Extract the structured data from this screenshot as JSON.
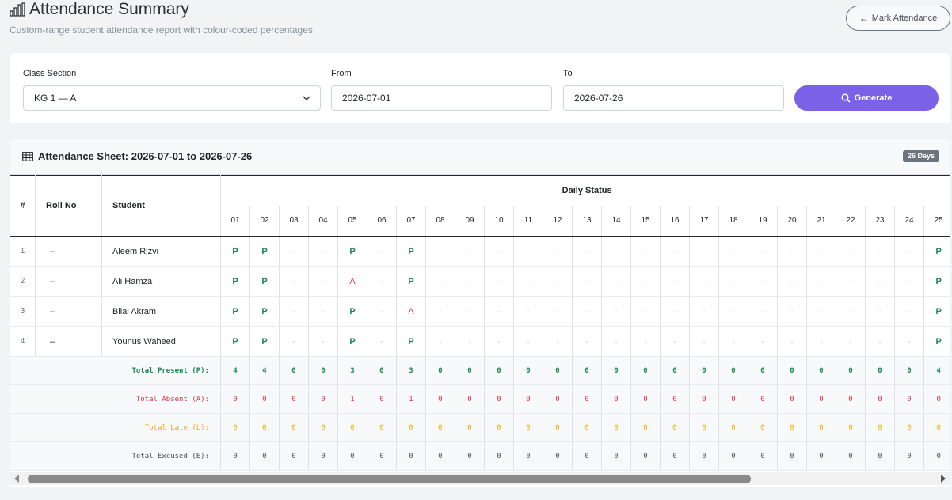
{
  "header": {
    "title": "Attendance Summary",
    "subtitle": "Custom-range student attendance report with colour-coded percentages",
    "mark_button": "Mark Attendance"
  },
  "filters": {
    "class_label": "Class Section",
    "class_value": "KG 1 — A",
    "from_label": "From",
    "from_value": "2026-07-01",
    "to_label": "To",
    "to_value": "2026-07-26",
    "generate_label": "Generate"
  },
  "sheet": {
    "title": "Attendance Sheet: 2026-07-01 to 2026-07-26",
    "days_badge": "26 Days",
    "col_index": "#",
    "col_roll": "Roll No",
    "col_student": "Student",
    "col_daily": "Daily Status",
    "days": [
      "01",
      "02",
      "03",
      "04",
      "05",
      "06",
      "07",
      "08",
      "09",
      "10",
      "11",
      "12",
      "13",
      "14",
      "15",
      "16",
      "17",
      "18",
      "19",
      "20",
      "21",
      "22",
      "23",
      "24",
      "25"
    ],
    "students": [
      {
        "index": "1",
        "roll": "–",
        "name": "Aleem Rizvi",
        "status": [
          "P",
          "P",
          "-",
          "-",
          "P",
          "-",
          "P",
          "-",
          "-",
          "-",
          "-",
          "-",
          "-",
          "-",
          "-",
          "-",
          "-",
          "-",
          "-",
          "-",
          "-",
          "-",
          "-",
          "-",
          "P"
        ]
      },
      {
        "index": "2",
        "roll": "–",
        "name": "Ali Hamza",
        "status": [
          "P",
          "P",
          "-",
          "-",
          "A",
          "-",
          "P",
          "-",
          "-",
          "-",
          "-",
          "-",
          "-",
          "-",
          "-",
          "-",
          "-",
          "-",
          "-",
          "-",
          "-",
          "-",
          "-",
          "-",
          "P"
        ]
      },
      {
        "index": "3",
        "roll": "–",
        "name": "Bilal Akram",
        "status": [
          "P",
          "P",
          "-",
          "-",
          "P",
          "-",
          "A",
          "-",
          "-",
          "-",
          "-",
          "-",
          "-",
          "-",
          "-",
          "-",
          "-",
          "-",
          "-",
          "-",
          "-",
          "-",
          "-",
          "-",
          "P"
        ]
      },
      {
        "index": "4",
        "roll": "–",
        "name": "Younus Waheed",
        "status": [
          "P",
          "P",
          "-",
          "-",
          "P",
          "-",
          "P",
          "-",
          "-",
          "-",
          "-",
          "-",
          "-",
          "-",
          "-",
          "-",
          "-",
          "-",
          "-",
          "-",
          "-",
          "-",
          "-",
          "-",
          "P"
        ]
      }
    ],
    "totals": [
      {
        "label": "Total Present (P):",
        "kind": "p",
        "values": [
          "4",
          "4",
          "0",
          "0",
          "3",
          "0",
          "3",
          "0",
          "0",
          "0",
          "0",
          "0",
          "0",
          "0",
          "0",
          "0",
          "0",
          "0",
          "0",
          "0",
          "0",
          "0",
          "0",
          "0",
          "4"
        ]
      },
      {
        "label": "Total Absent (A):",
        "kind": "a",
        "values": [
          "0",
          "0",
          "0",
          "0",
          "1",
          "0",
          "1",
          "0",
          "0",
          "0",
          "0",
          "0",
          "0",
          "0",
          "0",
          "0",
          "0",
          "0",
          "0",
          "0",
          "0",
          "0",
          "0",
          "0",
          "0"
        ]
      },
      {
        "label": "Total Late (L):",
        "kind": "l",
        "values": [
          "0",
          "0",
          "0",
          "0",
          "0",
          "0",
          "0",
          "0",
          "0",
          "0",
          "0",
          "0",
          "0",
          "0",
          "0",
          "0",
          "0",
          "0",
          "0",
          "0",
          "0",
          "0",
          "0",
          "0",
          "0"
        ]
      },
      {
        "label": "Total Excused (E):",
        "kind": "e",
        "values": [
          "0",
          "0",
          "0",
          "0",
          "0",
          "0",
          "0",
          "0",
          "0",
          "0",
          "0",
          "0",
          "0",
          "0",
          "0",
          "0",
          "0",
          "0",
          "0",
          "0",
          "0",
          "0",
          "0",
          "0",
          "0"
        ]
      }
    ]
  },
  "colors": {
    "accent": "#7b61e8",
    "present": "#198754",
    "absent": "#dc3545",
    "late": "#f0ad00"
  },
  "scroll": {
    "horizontal_position": 0.0
  }
}
